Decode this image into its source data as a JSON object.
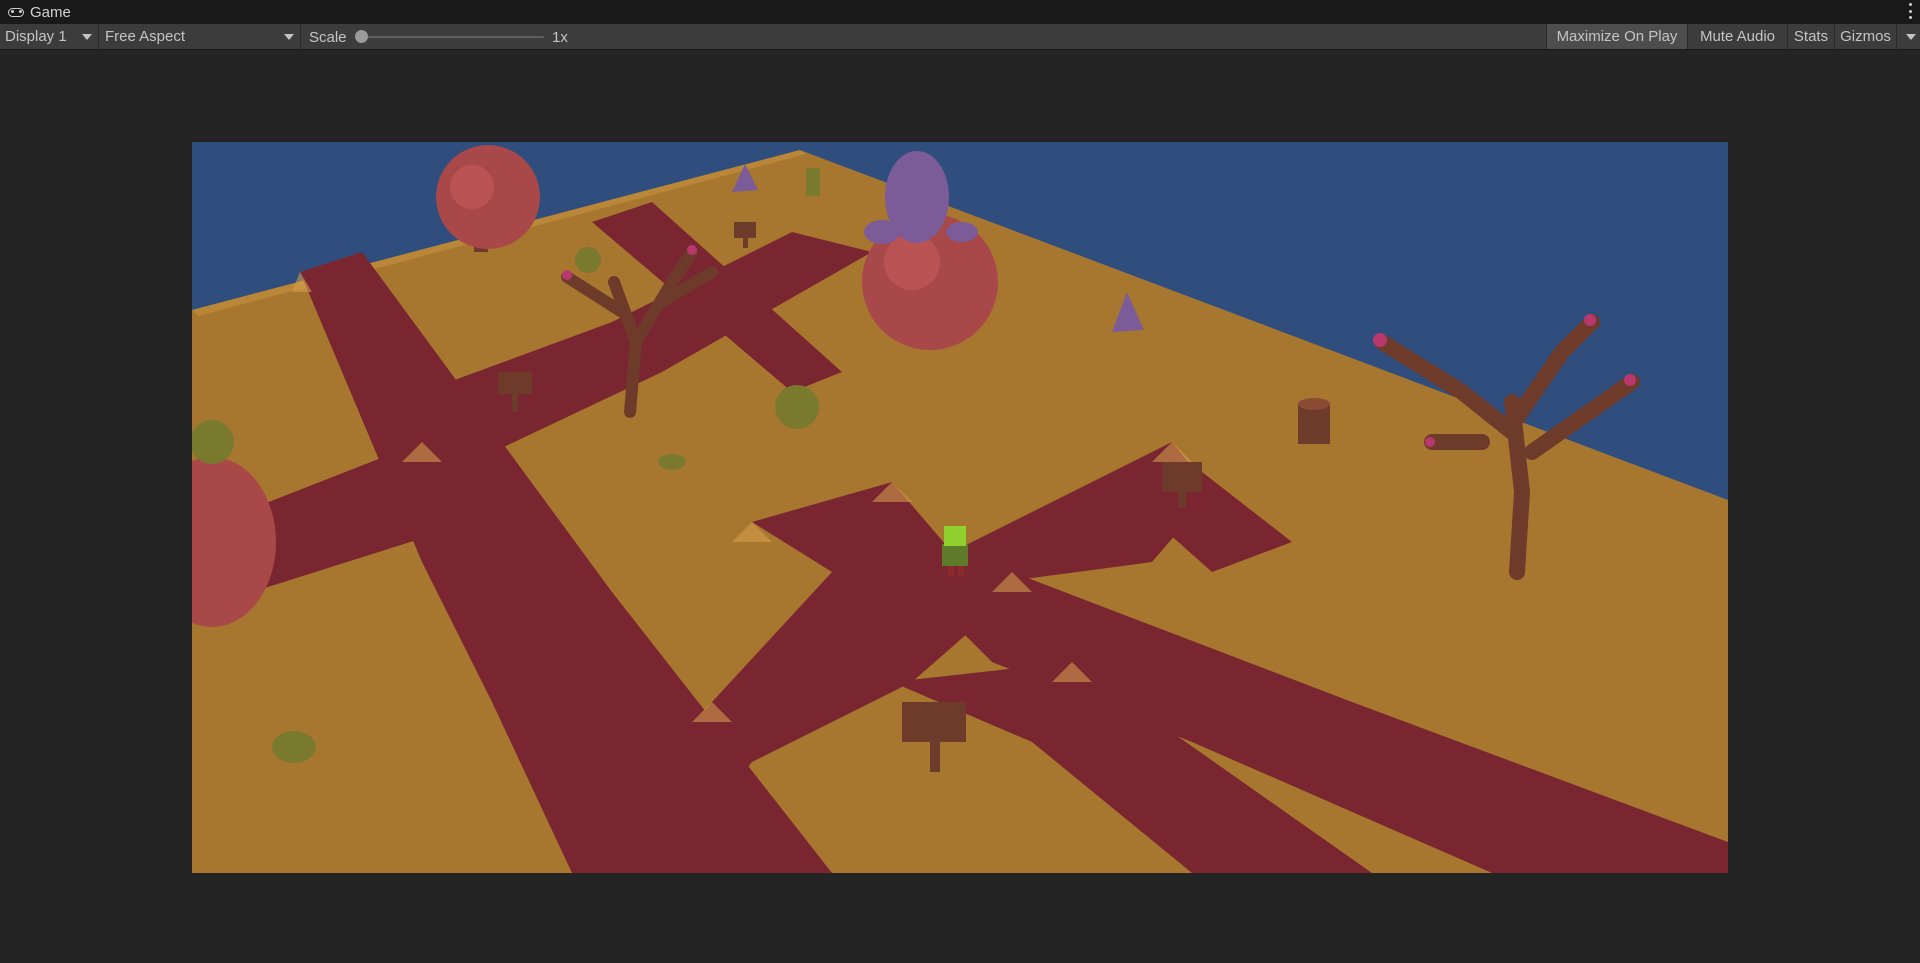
{
  "tab": {
    "title": "Game",
    "icon": "gamepad-icon"
  },
  "toolbar": {
    "display": "Display 1",
    "aspect": "Free Aspect",
    "scale_label": "Scale",
    "scale_value": "1x",
    "scale_fraction": 0.0,
    "maximize_label": "Maximize On Play",
    "maximize_on": true,
    "mute_label": "Mute Audio",
    "stats_label": "Stats",
    "gizmos_label": "Gizmos"
  },
  "colors": {
    "editor_bg": "#242424",
    "toolbar_bg": "#3c3c3c",
    "sky": "#2f4e7e",
    "ground": "#a8772f",
    "path": "#7a2630",
    "foliage": "#a84848",
    "bark": "#6e3a2a",
    "rock": "#7c5c98"
  }
}
